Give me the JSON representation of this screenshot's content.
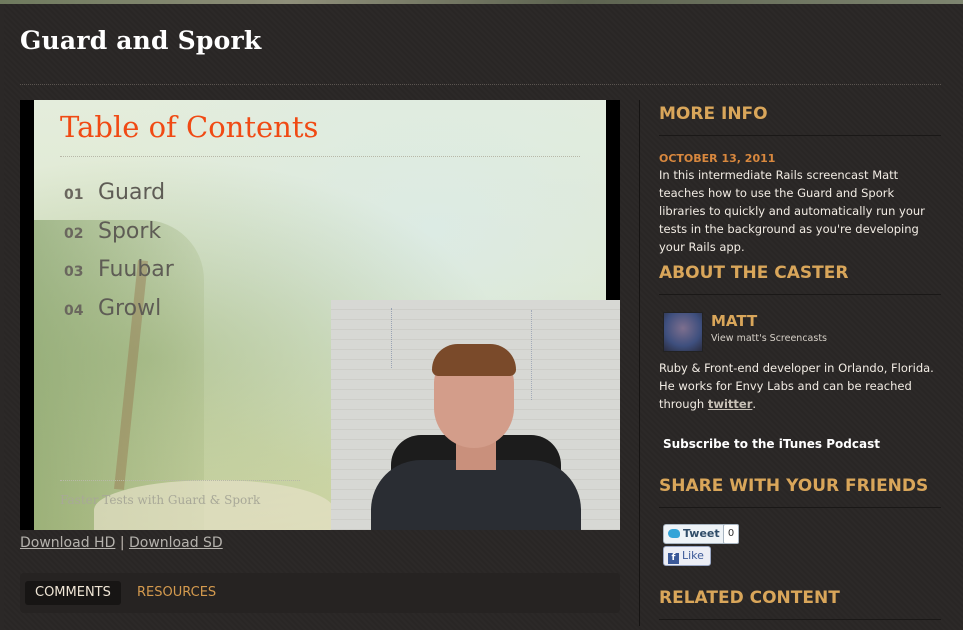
{
  "page": {
    "title": "Guard and Spork"
  },
  "video": {
    "slide": {
      "heading": "Table of Contents",
      "items": [
        {
          "num": "01",
          "label": "Guard"
        },
        {
          "num": "02",
          "label": "Spork"
        },
        {
          "num": "03",
          "label": "Fuubar"
        },
        {
          "num": "04",
          "label": "Growl"
        }
      ],
      "footer": "Faster Tests with Guard & Spork"
    }
  },
  "downloads": {
    "hd": "Download HD",
    "separator": "|",
    "sd": "Download SD"
  },
  "tabs": [
    {
      "label": "COMMENTS",
      "active": true
    },
    {
      "label": "RESOURCES",
      "active": false
    }
  ],
  "sidebar": {
    "more_info": {
      "heading": "MORE INFO",
      "date": "OCTOBER 13, 2011",
      "description": "In this intermediate Rails screencast Matt teaches how to use the Guard and Spork libraries to quickly and automatically run your tests in the background as you're developing your Rails app."
    },
    "caster": {
      "heading": "ABOUT THE CASTER",
      "name": "MATT",
      "link": "View matt's Screencasts",
      "bio_text": "Ruby & Front-end developer in Orlando, Florida. He works for Envy Labs and can be reached through ",
      "bio_link": "twitter",
      "bio_end": ".",
      "subscribe": "Subscribe to the iTunes Podcast"
    },
    "share": {
      "heading": "SHARE WITH YOUR FRIENDS",
      "tweet_label": "Tweet",
      "tweet_count": "0",
      "like_label": "Like"
    },
    "related": {
      "heading": "RELATED CONTENT"
    }
  },
  "colors": {
    "background": "#2b2827",
    "accent": "#d9a65a",
    "date": "#d9883e",
    "slide_heading": "#f04a14"
  },
  "icons": [
    "twitter-bird-icon",
    "facebook-f-icon"
  ]
}
